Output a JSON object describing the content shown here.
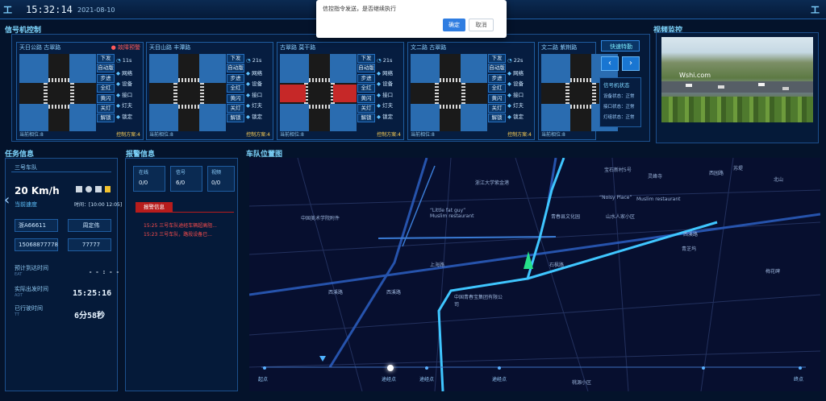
{
  "topbar": {
    "logo": "工",
    "time": "15:32:14",
    "date": "2021-08-10",
    "right_logo": "工"
  },
  "dialog": {
    "message": "信控指令发送，是否继续执行",
    "ok": "确定",
    "cancel": "取消"
  },
  "signal_panel": {
    "title": "信号机控制",
    "cards": [
      {
        "name": "天日公路 古翠路",
        "alarm": "● 故障预警",
        "timer": "11s",
        "foot": "当前相位:8",
        "foot2": "控制方案:4"
      },
      {
        "name": "天目山路 丰潭路",
        "alarm": "",
        "timer": "21s",
        "foot": "当前相位:8",
        "foot2": "控制方案:4"
      },
      {
        "name": "古翠路 莫干路",
        "alarm": "",
        "timer": "21s",
        "foot": "当前相位:8",
        "foot2": "控制方案:4"
      },
      {
        "name": "文二路 古翠路",
        "alarm": "",
        "timer": "22s",
        "foot": "当前相位:8",
        "foot2": "控制方案:4"
      },
      {
        "name": "文二路 紫荆路",
        "alarm": "",
        "timer": "",
        "foot": "当前相位:8",
        "foot2": "控制方案:4"
      }
    ],
    "buttons": [
      "下发",
      "自动版",
      "步进",
      "全红",
      "黄闪",
      "关灯",
      "解锁"
    ],
    "stats": [
      "网络",
      "设备",
      "接口",
      "灯夫",
      "锁定"
    ],
    "quick_ops": "快速特勤",
    "status_box": {
      "title": "信号机状态",
      "rows": [
        "设备状态：正常",
        "接口状态：正常",
        "灯组状态：正常"
      ]
    }
  },
  "video_panel": {
    "title": "视频监控",
    "watermark": "Wshi.com"
  },
  "task_panel": {
    "title": "任务信息",
    "car_tab": "三号车队",
    "speed": "20 Km/h",
    "speed_label": "当前速度",
    "time_window": "时间：[10:00 12:05]",
    "plate": "浙A66611",
    "driver": "周定伟",
    "phone": "15068877778",
    "code": "77777",
    "rows": [
      {
        "label": "预计到达时间",
        "sub": "EAT",
        "value": "- - : - -"
      },
      {
        "label": "实际出发时间",
        "sub": "ADT",
        "value": "15:25:16"
      },
      {
        "label": "已行驶时间",
        "sub": "TT",
        "value": "6分58秒"
      }
    ]
  },
  "alarm_panel": {
    "title": "报警信息",
    "stats": [
      {
        "label": "在线",
        "value": "0/0"
      },
      {
        "label": "信号",
        "value": "6/0"
      },
      {
        "label": "视频",
        "value": "0/0"
      }
    ],
    "tab": "报警信息",
    "items": [
      "15:25 三号车队途经车辆超高阻...",
      "15:23 三号车队，路段设备已..."
    ]
  },
  "map_panel": {
    "title": "车队位置图",
    "labels": [
      "中国美术学院附件",
      "“Little fat guy” Muslim restaurant",
      "西溪路",
      "西溪路",
      "中国青春宝集团有限公司",
      "浙江大学紫金港",
      "“Noisy Place”",
      "Muslim restaurant",
      "青春县文化园",
      "山水人家小区",
      "西溪路",
      "梅花碑",
      "青芝坞",
      "桃源小区",
      "上海路",
      "石枫路",
      "苏堤",
      "北山",
      "灵峰寺",
      "西园路",
      "宝石新村5号"
    ],
    "timeline": [
      "起点",
      "途经点",
      "途经点",
      "途经点",
      "终点"
    ]
  }
}
